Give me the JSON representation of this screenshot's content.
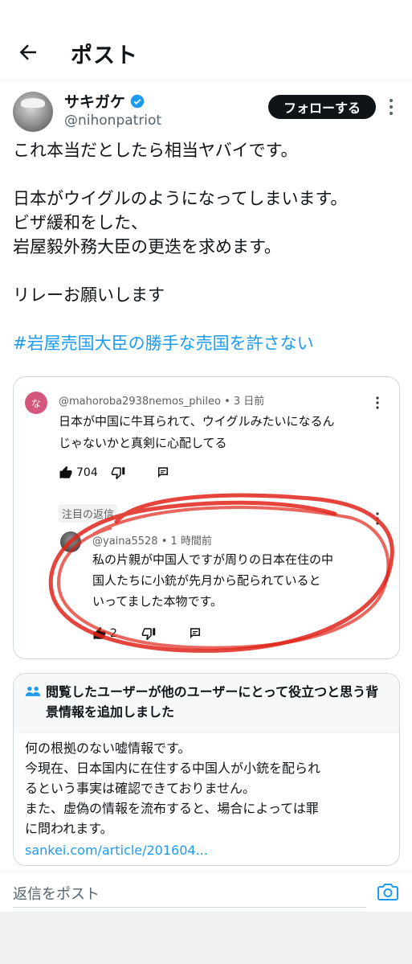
{
  "header": {
    "title": "ポスト"
  },
  "author": {
    "name": "サキガケ",
    "handle": "@nihonpatriot",
    "follow_label": "フォローする"
  },
  "tweet": {
    "lines": [
      "これ本当だとしたら相当ヤバイです。",
      "",
      "日本がウイグルのようになってしまいます。",
      "ビザ緩和をした、",
      "岩屋毅外務大臣の更迭を求めます。",
      "",
      "リレーお願いします",
      ""
    ],
    "hashtag": "#岩屋売国大臣の勝手な売国を許さない"
  },
  "embedded_comment": {
    "avatar_letter": "な",
    "author": "@mahoroba2938nemos_phileo",
    "time": "3 日前",
    "text_lines": [
      "日本が中国に牛耳られて、ウイグルみたいになるん",
      "じゃないかと真剣に心配してる"
    ],
    "likes": "704"
  },
  "embedded_reply": {
    "pinned_label": "注目の返信",
    "author": "@yaina5528",
    "time": "1 時間前",
    "text_lines": [
      "私の片親が中国人ですが周りの日本在住の中",
      "国人たちに小銃が先月から配られていると",
      "いってました本物です。"
    ],
    "likes": "2"
  },
  "community_note": {
    "title": "閲覧したユーザーが他のユーザーにとって役立つと思う背景情報を追加しました",
    "body_lines": [
      "何の根拠のない嘘情報です。",
      "今現在、日本国内に在住する中国人が小銃を配られ",
      "るという事実は確認できておりません。",
      "また、虚偽の情報を流布すると、場合によっては罪",
      "に問われます。"
    ],
    "link": "sankei.com/article/201604..."
  },
  "reply_bar": {
    "placeholder": "返信をポスト"
  },
  "colors": {
    "accent": "#1d9bf0",
    "verified": "#1d9bf0",
    "scribble": "#e0251b",
    "comment_avatar": "#d4587e"
  }
}
